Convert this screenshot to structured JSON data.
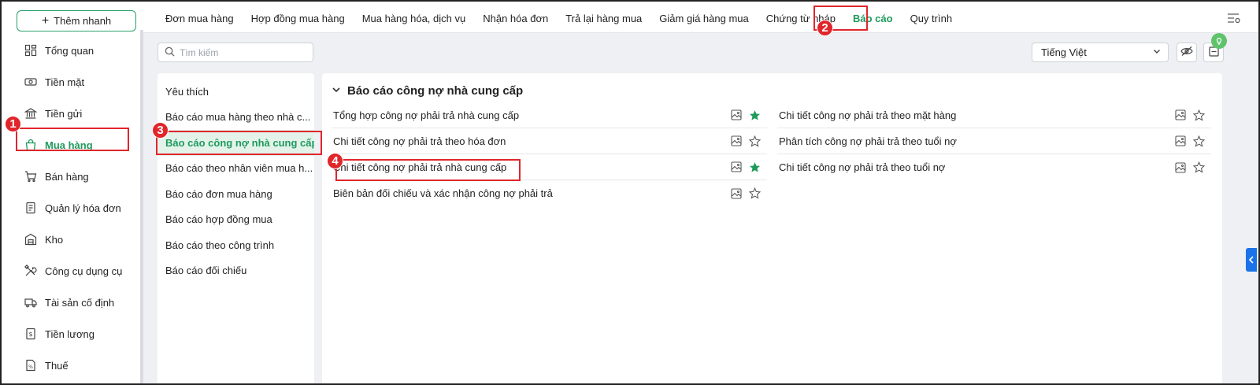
{
  "sidebar": {
    "quick_add_label": "Thêm nhanh",
    "items": [
      {
        "label": "Tổng quan",
        "icon": "dashboard-icon"
      },
      {
        "label": "Tiền mặt",
        "icon": "cash-icon"
      },
      {
        "label": "Tiền gửi",
        "icon": "bank-icon"
      },
      {
        "label": "Mua hàng",
        "icon": "shopping-bag-icon",
        "active": true
      },
      {
        "label": "Bán hàng",
        "icon": "cart-icon"
      },
      {
        "label": "Quản lý hóa đơn",
        "icon": "invoice-icon"
      },
      {
        "label": "Kho",
        "icon": "warehouse-icon"
      },
      {
        "label": "Công cụ dụng cụ",
        "icon": "tools-icon"
      },
      {
        "label": "Tài sản cố định",
        "icon": "truck-icon"
      },
      {
        "label": "Tiền lương",
        "icon": "salary-icon"
      },
      {
        "label": "Thuế",
        "icon": "tax-icon"
      }
    ]
  },
  "topbar": {
    "tabs": [
      {
        "label": "Đơn mua hàng"
      },
      {
        "label": "Hợp đồng mua hàng"
      },
      {
        "label": "Mua hàng hóa, dịch vụ"
      },
      {
        "label": "Nhận hóa đơn"
      },
      {
        "label": "Trả lại hàng mua"
      },
      {
        "label": "Giảm giá hàng mua"
      },
      {
        "label": "Chứng từ nháp"
      },
      {
        "label": "Báo cáo",
        "active": true
      },
      {
        "label": "Quy trình"
      }
    ]
  },
  "toolbar": {
    "search_placeholder": "Tìm kiếm",
    "language": "Tiếng Việt"
  },
  "report_groups": [
    {
      "label": "Yêu thích"
    },
    {
      "label": "Báo cáo mua hàng theo nhà c..."
    },
    {
      "label": "Báo cáo công nợ nhà cung cấp",
      "active": true
    },
    {
      "label": "Báo cáo theo nhân viên mua h..."
    },
    {
      "label": "Báo cáo đơn mua hàng"
    },
    {
      "label": "Báo cáo hợp đồng mua"
    },
    {
      "label": "Báo cáo theo công trình"
    },
    {
      "label": "Báo cáo đối chiếu"
    }
  ],
  "panel": {
    "title": "Báo cáo công nợ nhà cung cấp",
    "left_reports": [
      {
        "label": "Tổng hợp công nợ phải trả nhà cung cấp",
        "favorite": true
      },
      {
        "label": "Chi tiết công nợ phải trả theo hóa đơn",
        "favorite": false
      },
      {
        "label": "Chi tiết công nợ phải trả nhà cung cấp",
        "favorite": true
      },
      {
        "label": "Biên bản đối chiếu và xác nhận công nợ phải trả",
        "favorite": false
      }
    ],
    "right_reports": [
      {
        "label": "Chi tiết công nợ phải trả theo mặt hàng",
        "favorite": false
      },
      {
        "label": "Phân tích công nợ phải trả theo tuổi nợ",
        "favorite": false
      },
      {
        "label": "Chi tiết công nợ phải trả theo tuổi nợ",
        "favorite": false
      }
    ]
  },
  "annotations": {
    "step1": "1",
    "step2": "2",
    "step3": "3",
    "step4": "4"
  },
  "colors": {
    "accent_green": "#1f9a5d",
    "annotation_red": "#e0262b",
    "edge_tab_blue": "#1a73e8"
  }
}
